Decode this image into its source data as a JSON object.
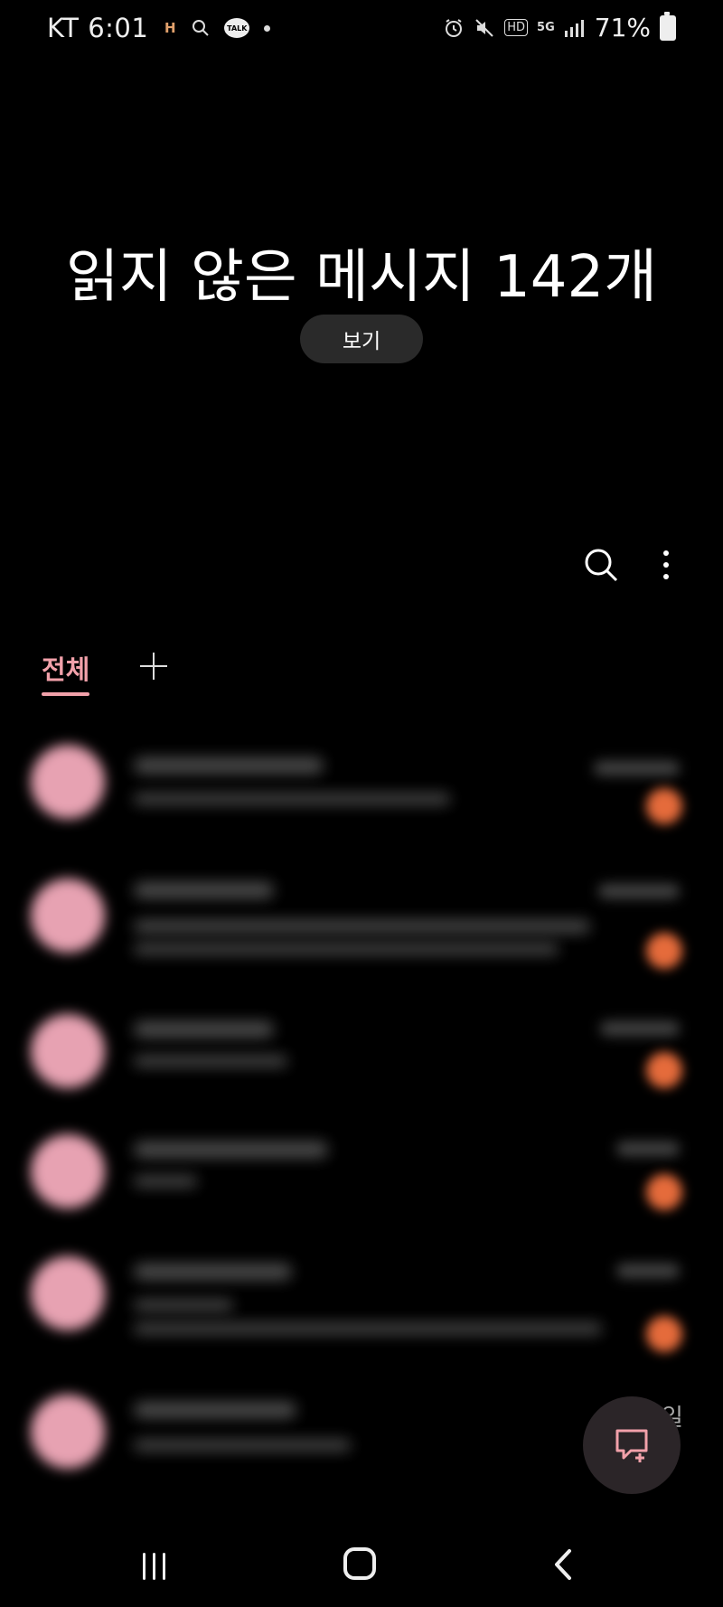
{
  "status_bar": {
    "carrier_time": "KT 6:01",
    "battery": "71%",
    "icons": [
      "h-icon",
      "search-icon",
      "kakaotalk-icon",
      "dot-icon",
      "alarm-icon",
      "mute-icon",
      "hd-icon",
      "5g-icon",
      "signal-icon",
      "battery-icon"
    ],
    "talk_label": "TALK",
    "hd_label": "HD",
    "fiveg_label": "5G"
  },
  "header": {
    "title": "읽지 않은 메시지 142개",
    "view_button": "보기"
  },
  "toolbar": {
    "search_icon": "search-icon",
    "more_icon": "more-vertical-icon"
  },
  "tabs": {
    "all": "전체",
    "add_icon": "plus-icon"
  },
  "list": {
    "conversations_count_visible": 6
  },
  "fab": {
    "icon": "new-message-icon"
  },
  "partial_label": "일",
  "colors": {
    "accent_pink": "#f2a1aa",
    "badge_orange": "#e56b3b",
    "avatar_pink": "#e7a2b2"
  }
}
